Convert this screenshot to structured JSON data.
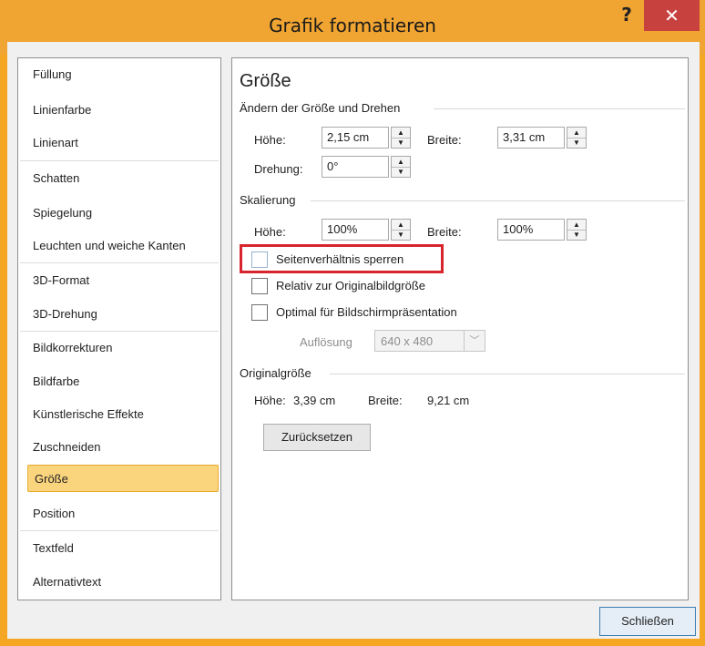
{
  "window": {
    "title": "Grafik formatieren",
    "help_label": "?",
    "close_label": "✕"
  },
  "nav": {
    "items": [
      {
        "label": "Füllung"
      },
      {
        "label": "Linienfarbe"
      },
      {
        "label": "Linienart"
      },
      {
        "label": "Schatten"
      },
      {
        "label": "Spiegelung"
      },
      {
        "label": "Leuchten und weiche Kanten"
      },
      {
        "label": "3D-Format"
      },
      {
        "label": "3D-Drehung"
      },
      {
        "label": "Bildkorrekturen"
      },
      {
        "label": "Bildfarbe"
      },
      {
        "label": "Künstlerische Effekte"
      },
      {
        "label": "Zuschneiden"
      },
      {
        "label": "Größe"
      },
      {
        "label": "Position"
      },
      {
        "label": "Textfeld"
      },
      {
        "label": "Alternativtext"
      }
    ],
    "selected": "Größe"
  },
  "panel": {
    "title": "Größe",
    "size_rotate": {
      "heading": "Ändern der Größe und Drehen",
      "height_label": "Höhe:",
      "height_value": "2,15 cm",
      "width_label": "Breite:",
      "width_value": "3,31 cm",
      "rotation_label": "Drehung:",
      "rotation_value": "0°"
    },
    "scale": {
      "heading": "Skalierung",
      "height_label": "Höhe:",
      "height_value": "100%",
      "width_label": "Breite:",
      "width_value": "100%",
      "lock_aspect_label": "Seitenverhältnis sperren",
      "relative_label": "Relativ zur Originalbildgröße",
      "best_scale_label": "Optimal für Bildschirmpräsentation",
      "resolution_label": "Auflösung",
      "resolution_value": "640 x 480"
    },
    "original": {
      "heading": "Originalgröße",
      "height_label": "Höhe:",
      "height_value": "3,39 cm",
      "width_label": "Breite:",
      "width_value": "9,21 cm"
    },
    "reset_label": "Zurücksetzen"
  },
  "footer": {
    "close_label": "Schließen"
  },
  "colors": {
    "title_bar": "#f0a431",
    "close_button": "#c7413e",
    "selection": "#fbd57e",
    "highlight": "#d8242d"
  }
}
